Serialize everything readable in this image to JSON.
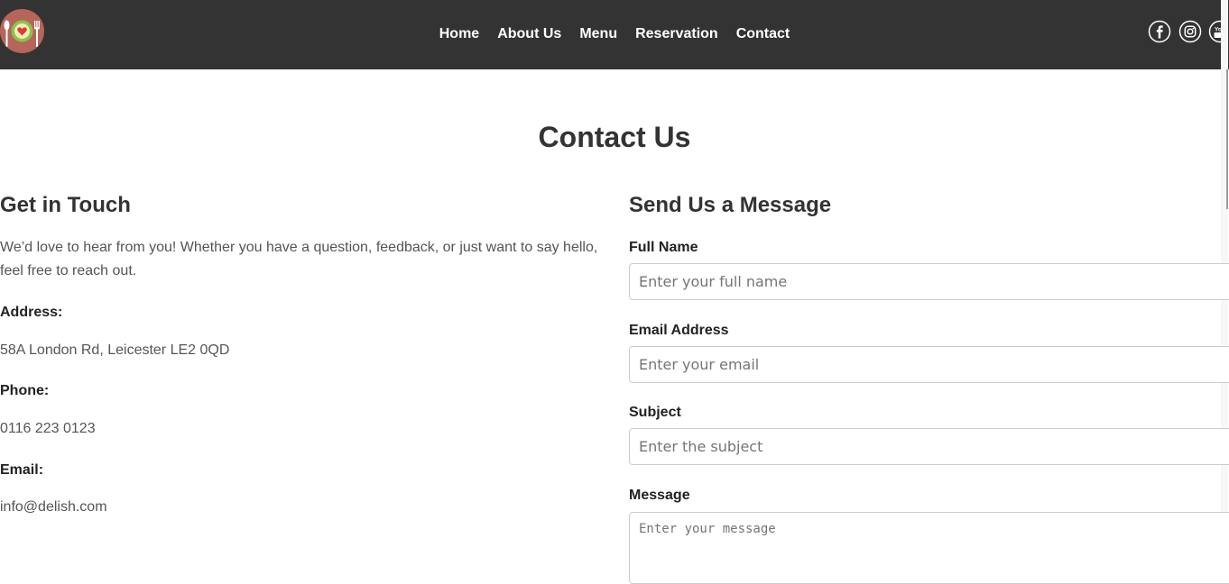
{
  "header": {
    "logo_icon": "plate-with-heart-and-cutlery-icon",
    "nav": [
      {
        "label": "Home"
      },
      {
        "label": "About Us"
      },
      {
        "label": "Menu"
      },
      {
        "label": "Reservation"
      },
      {
        "label": "Contact"
      }
    ],
    "social_icons": [
      "facebook-icon",
      "instagram-icon",
      "youtube-icon"
    ],
    "youtube_text": "You"
  },
  "page": {
    "title": "Contact Us"
  },
  "left": {
    "heading": "Get in Touch",
    "intro": "We’d love to hear from you! Whether you have a question, feedback, or just want to say hello, feel free to reach out.",
    "address_label": "Address:",
    "address": "58A London Rd, Leicester LE2 0QD",
    "phone_label": "Phone:",
    "phone": "0116 223 0123",
    "email_label": "Email:",
    "email": "info@delish.com"
  },
  "form": {
    "heading": "Send Us a Message",
    "name_label": "Full Name",
    "name_placeholder": "Enter your full name",
    "email_label": "Email Address",
    "email_placeholder": "Enter your email",
    "subject_label": "Subject",
    "subject_placeholder": "Enter the subject",
    "message_label": "Message",
    "message_placeholder": "Enter your message"
  },
  "colors": {
    "navbar": "#333333",
    "nav_text": "#ffffff",
    "heading_text": "#333333",
    "body_text": "#555555",
    "logo_bg": "#b5655a",
    "logo_plate": "#8bc34a"
  }
}
